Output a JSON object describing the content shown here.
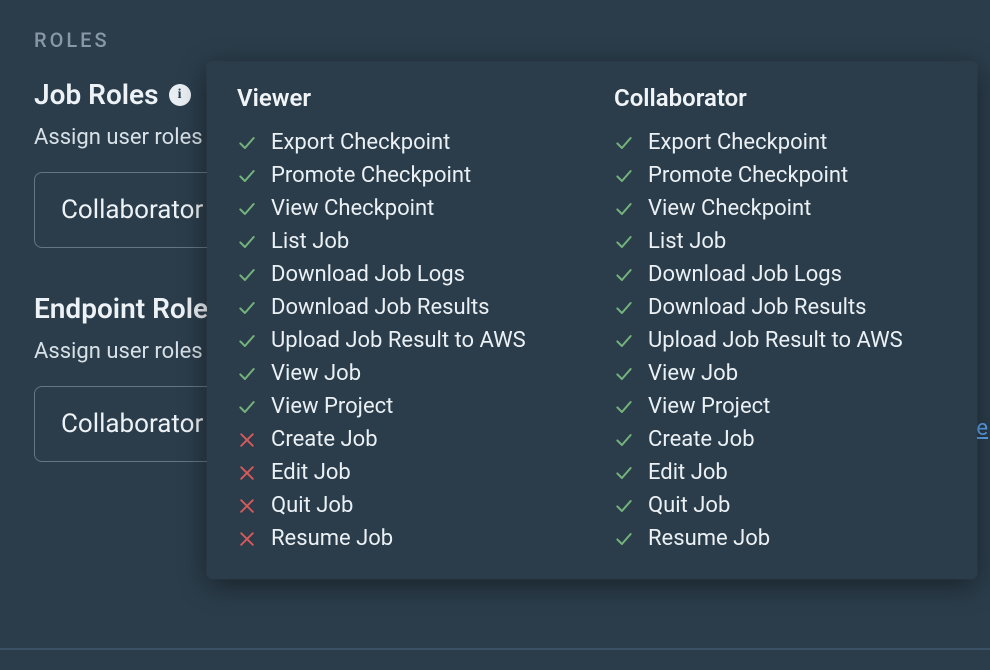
{
  "section_label": "ROLES",
  "job_roles": {
    "heading": "Job Roles",
    "subtext": "Assign user roles",
    "dropdown_value": "Collaborator"
  },
  "endpoint_roles": {
    "heading": "Endpoint Roles",
    "subtext": "Assign user roles",
    "dropdown_value": "Collaborator"
  },
  "link_peek_text": "e",
  "info_glyph": "i",
  "popover": {
    "columns": [
      {
        "title": "Viewer",
        "permissions": [
          {
            "label": "Export Checkpoint",
            "allowed": true
          },
          {
            "label": "Promote Checkpoint",
            "allowed": true
          },
          {
            "label": "View Checkpoint",
            "allowed": true
          },
          {
            "label": "List Job",
            "allowed": true
          },
          {
            "label": "Download Job Logs",
            "allowed": true
          },
          {
            "label": "Download Job Results",
            "allowed": true
          },
          {
            "label": "Upload Job Result to AWS",
            "allowed": true
          },
          {
            "label": "View Job",
            "allowed": true
          },
          {
            "label": "View Project",
            "allowed": true
          },
          {
            "label": "Create Job",
            "allowed": false
          },
          {
            "label": "Edit Job",
            "allowed": false
          },
          {
            "label": "Quit Job",
            "allowed": false
          },
          {
            "label": "Resume Job",
            "allowed": false
          }
        ]
      },
      {
        "title": "Collaborator",
        "permissions": [
          {
            "label": "Export Checkpoint",
            "allowed": true
          },
          {
            "label": "Promote Checkpoint",
            "allowed": true
          },
          {
            "label": "View Checkpoint",
            "allowed": true
          },
          {
            "label": "List Job",
            "allowed": true
          },
          {
            "label": "Download Job Logs",
            "allowed": true
          },
          {
            "label": "Download Job Results",
            "allowed": true
          },
          {
            "label": "Upload Job Result to AWS",
            "allowed": true
          },
          {
            "label": "View Job",
            "allowed": true
          },
          {
            "label": "View Project",
            "allowed": true
          },
          {
            "label": "Create Job",
            "allowed": true
          },
          {
            "label": "Edit Job",
            "allowed": true
          },
          {
            "label": "Quit Job",
            "allowed": true
          },
          {
            "label": "Resume Job",
            "allowed": true
          }
        ]
      }
    ]
  }
}
